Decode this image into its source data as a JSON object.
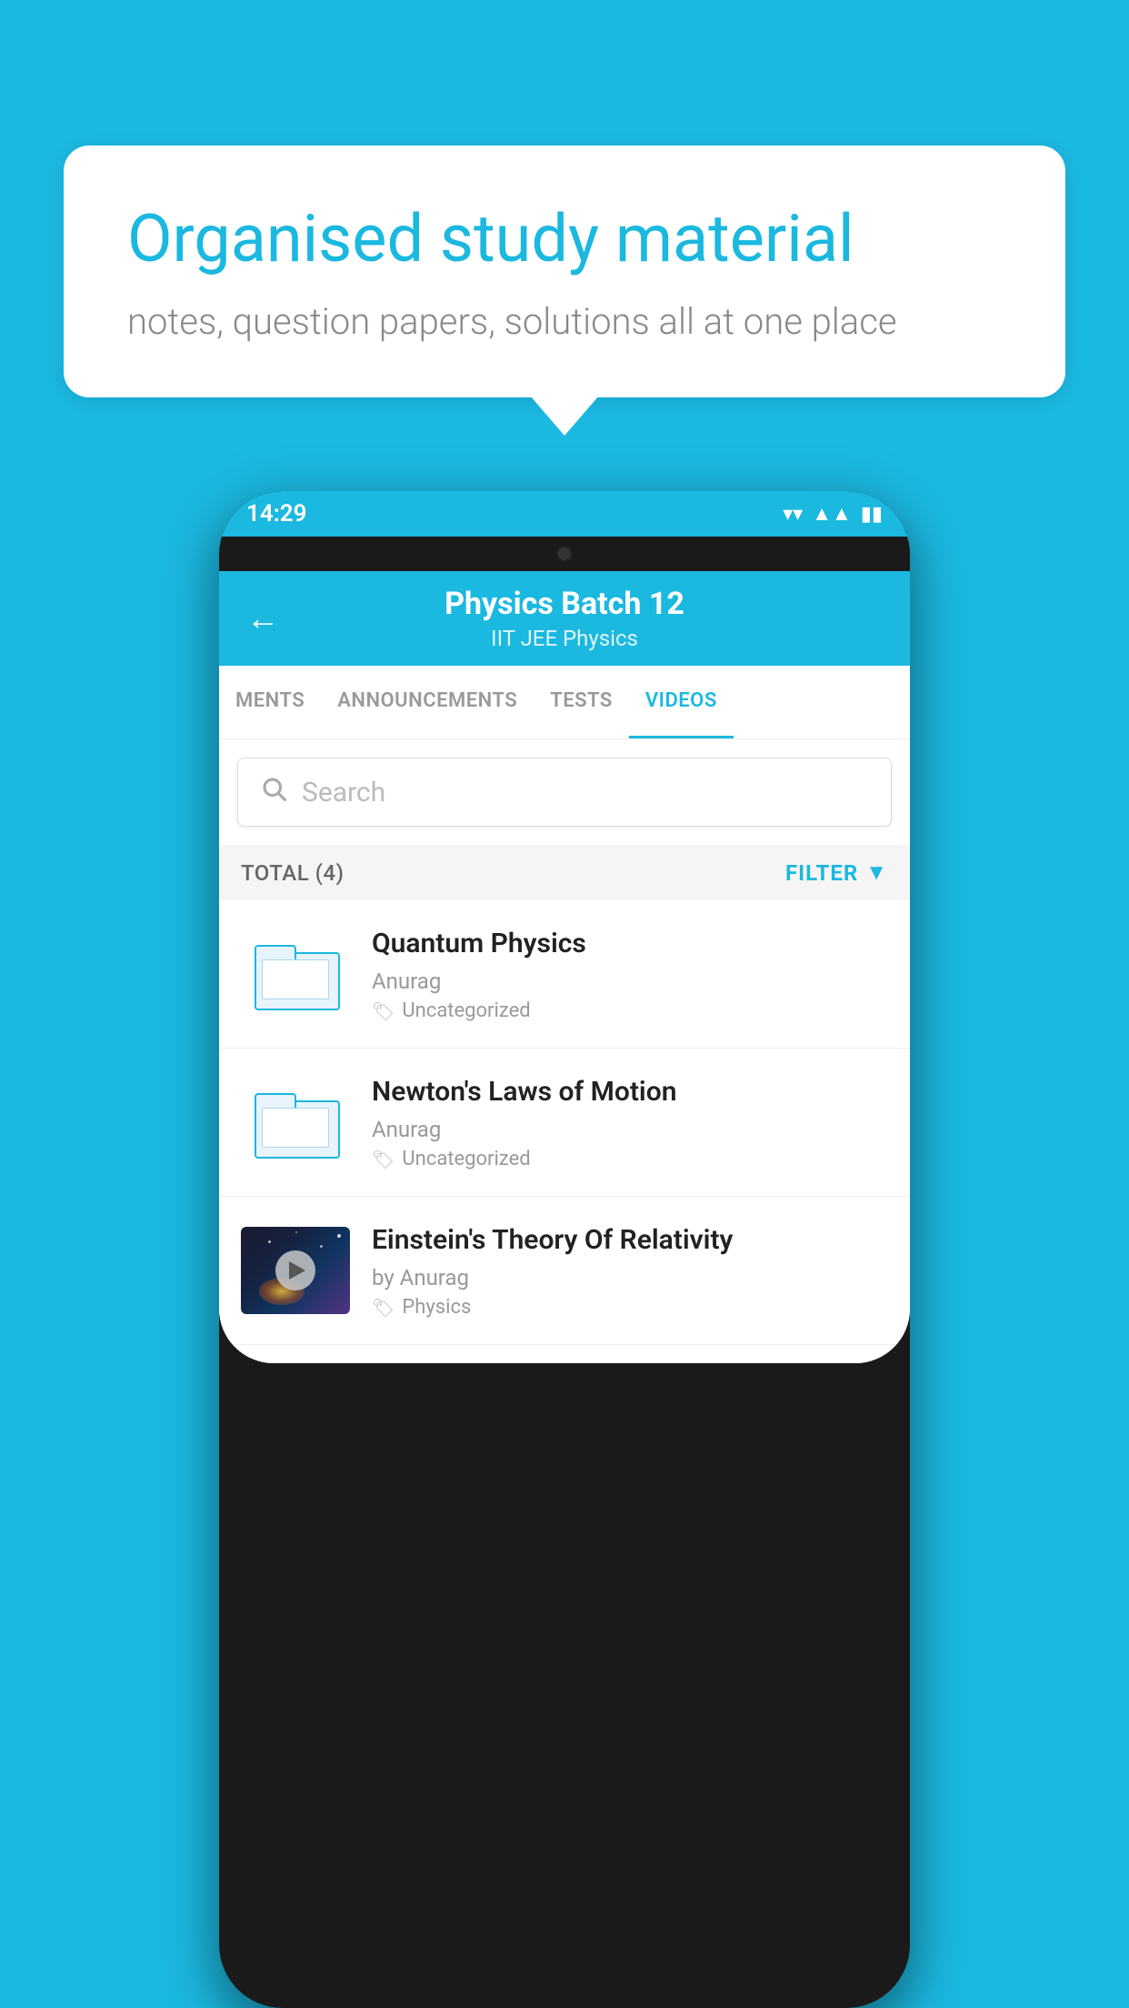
{
  "background": {
    "color": "#1bb8e0"
  },
  "speech_bubble": {
    "title": "Organised study material",
    "subtitle": "notes, question papers, solutions all at one place"
  },
  "phone": {
    "status_bar": {
      "time": "14:29",
      "icons": [
        "wifi",
        "signal",
        "battery"
      ]
    },
    "header": {
      "back_label": "←",
      "title": "Physics Batch 12",
      "subtitle": "IIT JEE   Physics"
    },
    "tabs": [
      {
        "label": "MENTS",
        "active": false
      },
      {
        "label": "ANNOUNCEMENTS",
        "active": false
      },
      {
        "label": "TESTS",
        "active": false
      },
      {
        "label": "VIDEOS",
        "active": true
      }
    ],
    "search": {
      "placeholder": "Search"
    },
    "filter_row": {
      "total_label": "TOTAL (4)",
      "filter_label": "FILTER"
    },
    "videos": [
      {
        "id": 1,
        "title": "Quantum Physics",
        "author": "Anurag",
        "tag": "Uncategorized",
        "has_thumb": false
      },
      {
        "id": 2,
        "title": "Newton's Laws of Motion",
        "author": "Anurag",
        "tag": "Uncategorized",
        "has_thumb": false
      },
      {
        "id": 3,
        "title": "Einstein's Theory Of Relativity",
        "author": "by Anurag",
        "tag": "Physics",
        "has_thumb": true
      }
    ]
  }
}
